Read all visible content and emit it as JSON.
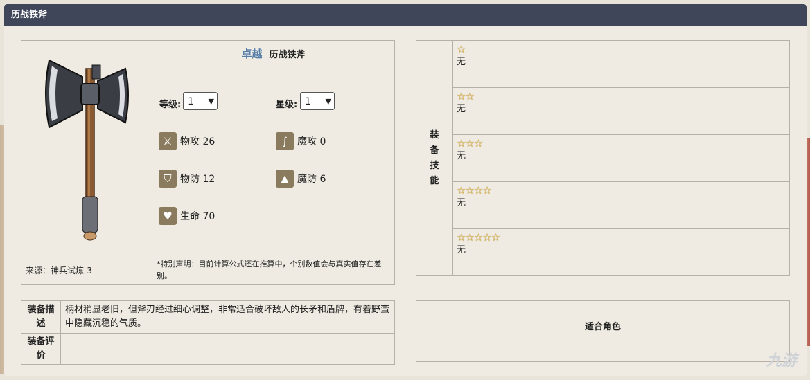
{
  "header": {
    "title": "历战铁斧"
  },
  "equipment": {
    "rarity": "卓越",
    "name": "历战铁斧",
    "level_label": "等级:",
    "level_value": "1",
    "star_label": "星级:",
    "star_value": "1",
    "stats": [
      {
        "icon": "sword-icon",
        "label": "物攻 26"
      },
      {
        "icon": "staff-icon",
        "label": "魔攻 0"
      },
      {
        "icon": "shield-icon",
        "label": "物防 12"
      },
      {
        "icon": "wizard-hat-icon",
        "label": "魔防 6"
      },
      {
        "icon": "heart-icon",
        "label": "生命 70"
      }
    ],
    "source": "来源：神兵试炼-3",
    "note": "*特别声明：目前计算公式还在推算中，个别数值会与真实值存在差别。"
  },
  "skills": {
    "label": "装备技能",
    "rows": [
      {
        "stars": "☆",
        "text": "无"
      },
      {
        "stars": "☆☆",
        "text": "无"
      },
      {
        "stars": "☆☆☆",
        "text": "无"
      },
      {
        "stars": "☆☆☆☆",
        "text": "无"
      },
      {
        "stars": "☆☆☆☆☆",
        "text": "无"
      }
    ]
  },
  "description": {
    "desc_label": "装备描述",
    "desc_text": "柄材稍显老旧，但斧刃经过细心调整，非常适合破坏敌人的长矛和盾牌，有着野蛮中隐藏沉稳的气质。",
    "eval_label": "装备评价",
    "eval_text": ""
  },
  "characters": {
    "title": "适合角色"
  },
  "watermark": "九游",
  "colors": {
    "header_bg": "#3f4659",
    "stat_icon_bg": "#8a7b5e",
    "star": "#e5b74a"
  }
}
